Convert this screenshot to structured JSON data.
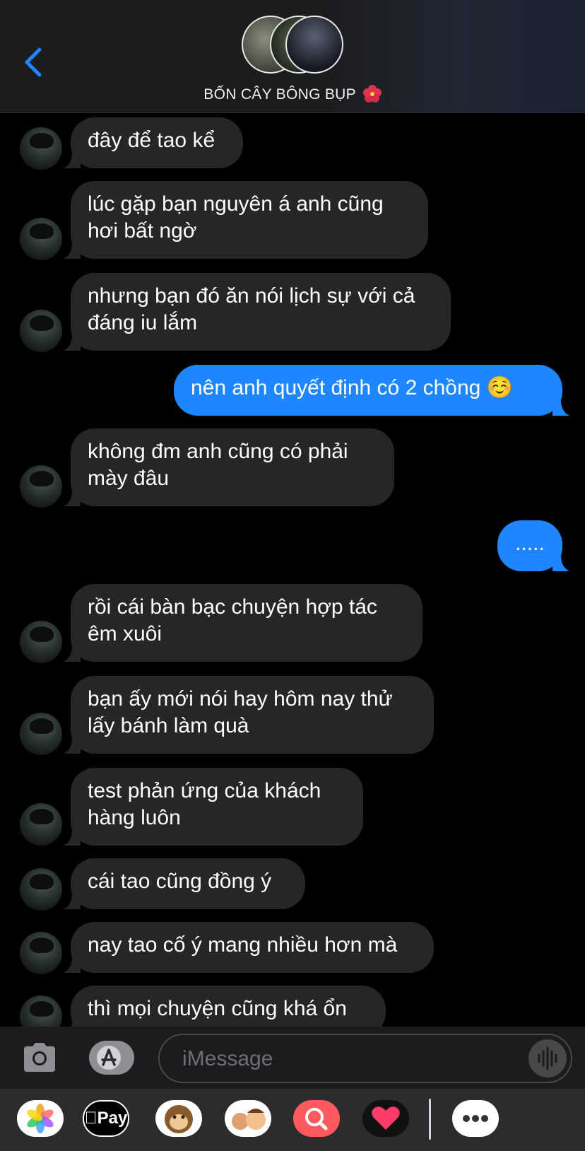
{
  "header": {
    "group_name": "BỐN CÂY BÔNG BỤP",
    "back_icon": "chevron-left-icon",
    "accent_color": "#1f86ff"
  },
  "messages": [
    {
      "direction": "in",
      "text": "đây để tao kể"
    },
    {
      "direction": "in",
      "text": "lúc gặp bạn nguyên á anh cũng\nhơi bất ngờ"
    },
    {
      "direction": "in",
      "text": "nhưng bạn đó ăn nói lịch sự với cả\nđáng iu lắm"
    },
    {
      "direction": "out",
      "text": "nên anh quyết định có 2 chồng ☺️"
    },
    {
      "direction": "in",
      "text": "không đm anh cũng có phải\nmày đâu"
    },
    {
      "direction": "out",
      "text": "....."
    },
    {
      "direction": "in",
      "text": "rồi cái bàn bạc chuyện hợp tác\nêm xuôi"
    },
    {
      "direction": "in",
      "text": "bạn ấy mới nói hay hôm nay thử\nlấy bánh làm quà"
    },
    {
      "direction": "in",
      "text": "test phản ứng của khách\nhàng luôn"
    },
    {
      "direction": "in",
      "text": "cái tao cũng đồng ý"
    },
    {
      "direction": "in",
      "text": "nay tao cố ý mang nhiều hơn mà"
    },
    {
      "direction": "in",
      "text": "thì mọi chuyện cũng khá ổn"
    }
  ],
  "composer": {
    "placeholder": "iMessage",
    "value": "",
    "camera_icon": "camera-icon",
    "apps_icon": "app-store-icon",
    "mic_icon": "audio-waveform-icon"
  },
  "app_drawer": {
    "apps": [
      "photos-icon",
      "apple-pay-icon",
      "monkey-emoji-icon",
      "memoji-icon",
      "web-search-icon",
      "heart-sticker-icon",
      "more-icon"
    ],
    "pay_label": "Pay"
  },
  "colors": {
    "incoming_bubble": "#262628",
    "outgoing_bubble": "#1f86ff",
    "background": "#000000"
  }
}
